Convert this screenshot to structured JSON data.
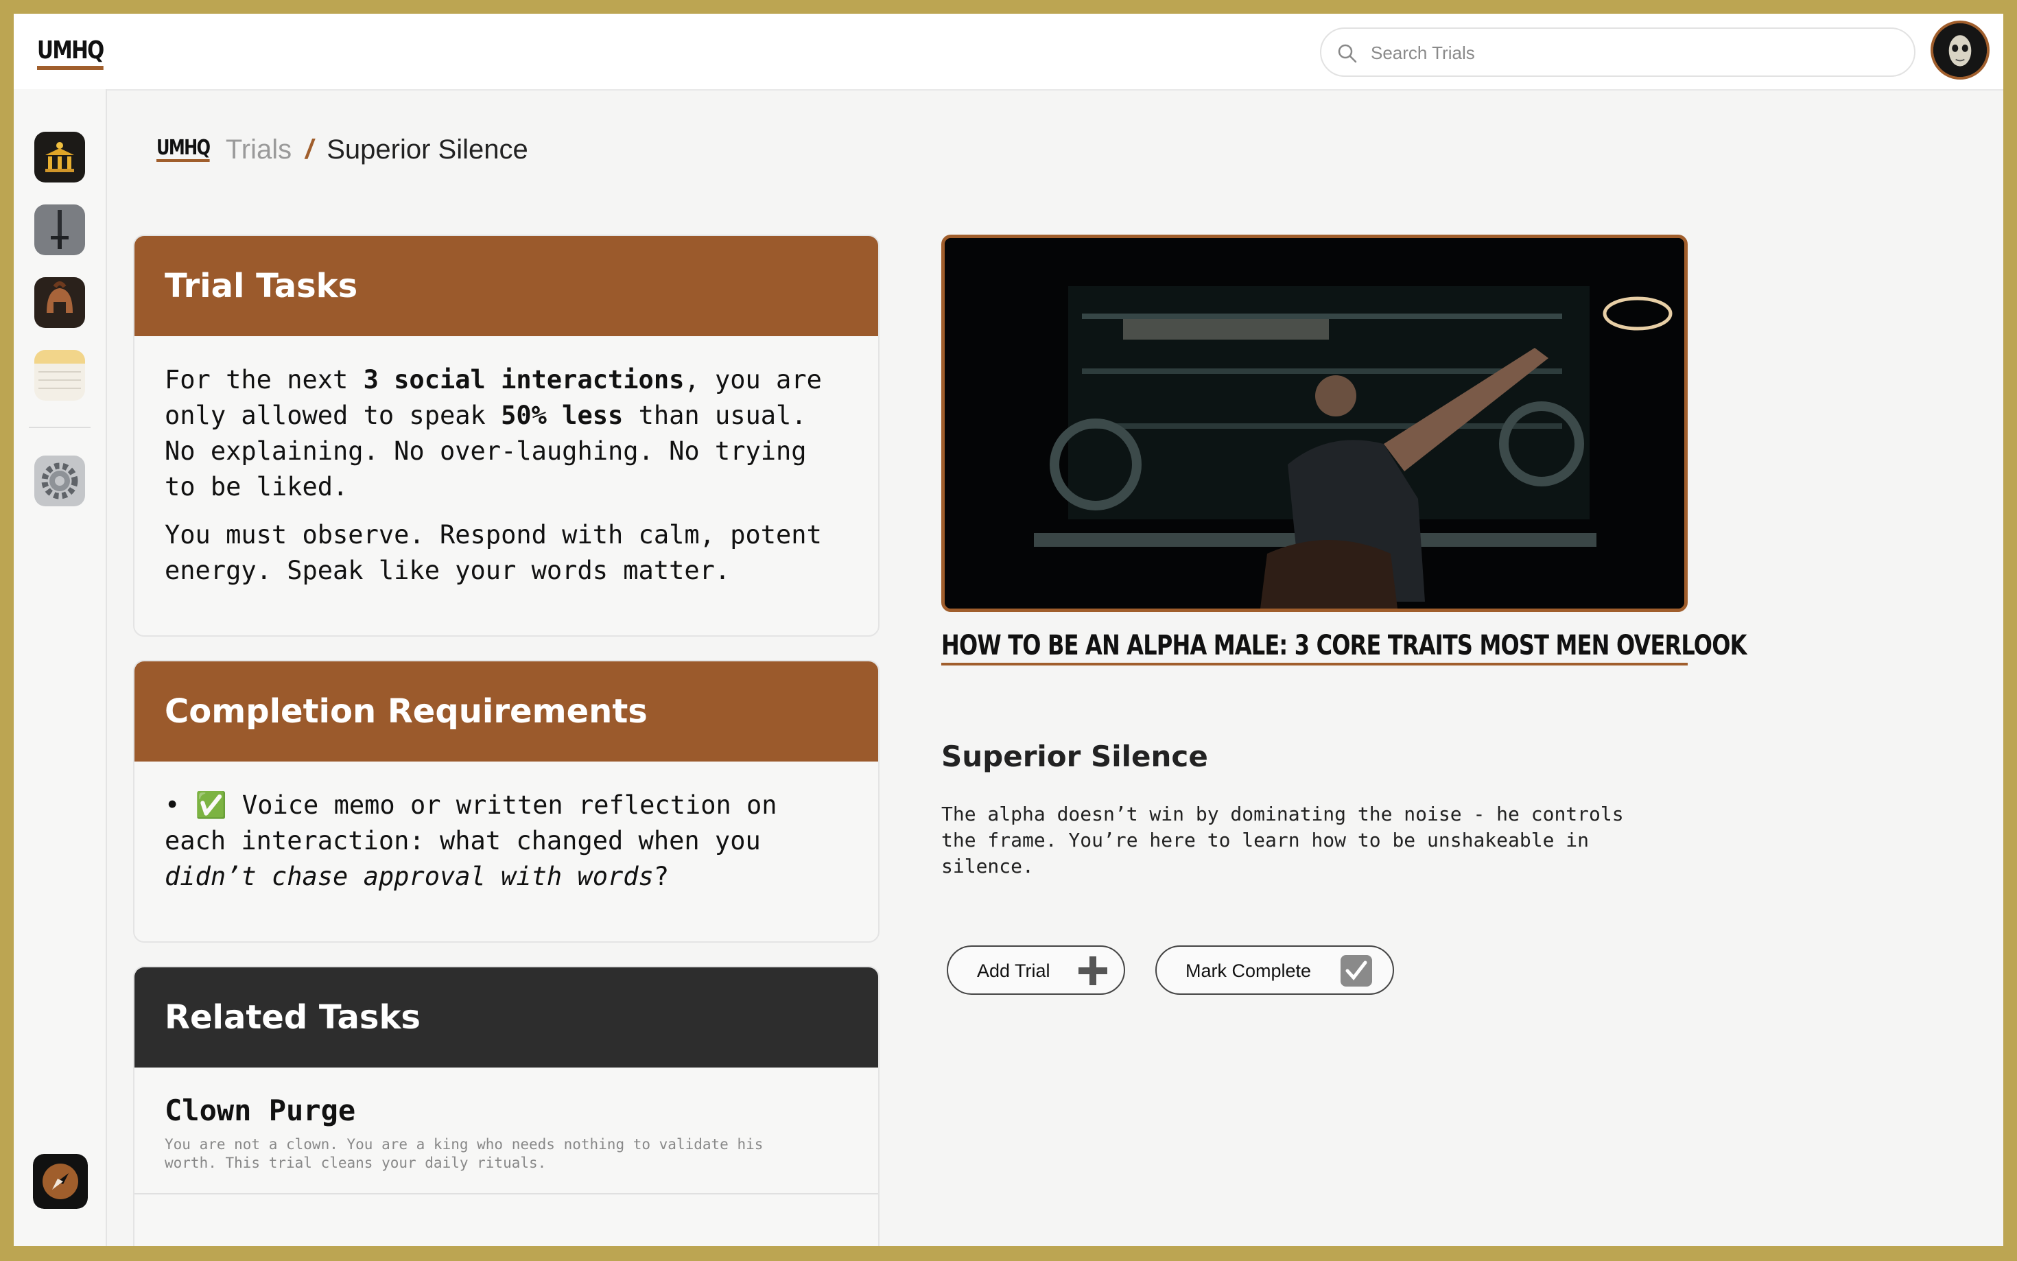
{
  "app": {
    "logo": "UMHQ"
  },
  "search": {
    "placeholder": "Search Trials"
  },
  "breadcrumb": {
    "logo": "UMHQ",
    "section": "Trials",
    "separator": "/",
    "current": "Superior Silence"
  },
  "trial_tasks": {
    "title": "Trial Tasks",
    "p1_a": "For the next ",
    "p1_b": "3 social interactions",
    "p1_c": ", you are only allowed to speak ",
    "p1_d": "50% less",
    "p1_e": " than usual. No explaining. No over-laughing. No trying to be liked.",
    "p2": "You must observe. Respond with calm, potent energy. Speak like your words matter."
  },
  "completion": {
    "title": "Completion Requirements",
    "bullet": "•",
    "check": "✅",
    "text_a": " Voice memo or written reflection on each interaction: what changed when you ",
    "text_em": "didn’t chase approval with words",
    "text_b": "?"
  },
  "related": {
    "title": "Related Tasks",
    "items": [
      {
        "title": "Clown Purge",
        "desc": "You are not a clown. You are a king who needs nothing to validate his worth. This trial cleans your daily rituals."
      }
    ]
  },
  "video": {
    "title": "HOW TO BE AN ALPHA MALE: 3 CORE TRAITS MOST MEN OVERLOOK"
  },
  "detail": {
    "heading": "Superior Silence",
    "desc": "The alpha doesn’t win by dominating the noise - he controls the frame. You’re here to learn how to be unshakeable in silence."
  },
  "actions": {
    "add_label": "Add Trial",
    "complete_label": "Mark Complete"
  },
  "colors": {
    "accent": "#9b5a2c",
    "dark_header": "#2d2d2d",
    "frame": "#bca552"
  }
}
